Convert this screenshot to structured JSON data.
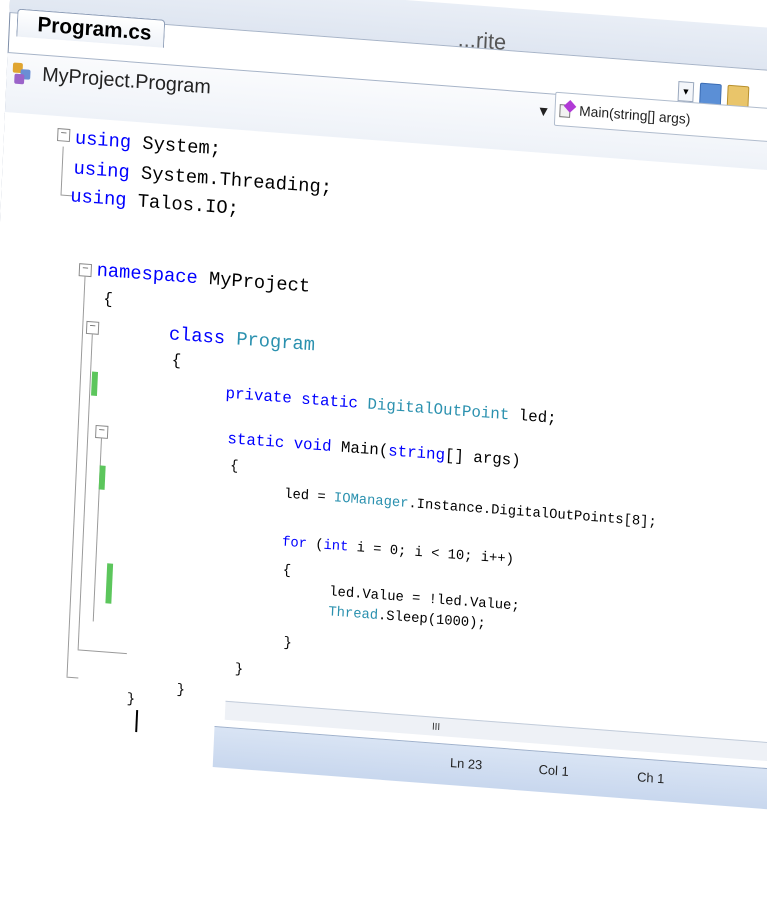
{
  "window": {
    "faded_title": "...rite"
  },
  "tab": {
    "label": "Program.cs"
  },
  "nav": {
    "class_selector": "MyProject.Program",
    "member_selector": "Main(string[] args)"
  },
  "code": {
    "lines": [
      [
        "using",
        " System;"
      ],
      [
        "using",
        " System.Threading;"
      ],
      [
        "using",
        " Talos.IO;"
      ],
      [
        "namespace",
        " MyProject"
      ],
      [
        "{",
        ""
      ],
      [
        "class",
        " Program"
      ],
      [
        "{",
        ""
      ],
      [
        "private static",
        " ",
        "DigitalOutPoint",
        " led;"
      ],
      [
        "static void",
        " Main(",
        "string",
        "[] args)"
      ],
      [
        "{",
        ""
      ],
      [
        "led = ",
        "IOManager",
        ".Instance.DigitalOutPoints[8];"
      ],
      [
        "for",
        " (",
        "int",
        " i = 0; i < 10; i++)"
      ],
      [
        "{",
        ""
      ],
      [
        "led.Value = !led.Value;"
      ],
      [
        "Thread",
        ".Sleep(1000);"
      ],
      [
        "}"
      ],
      [
        "}"
      ],
      [
        "}"
      ],
      [
        "}"
      ]
    ]
  },
  "scrollbar": {
    "thumb_label": "III"
  },
  "status": {
    "line": "Ln 23",
    "col": "Col 1",
    "ch": "Ch 1"
  }
}
